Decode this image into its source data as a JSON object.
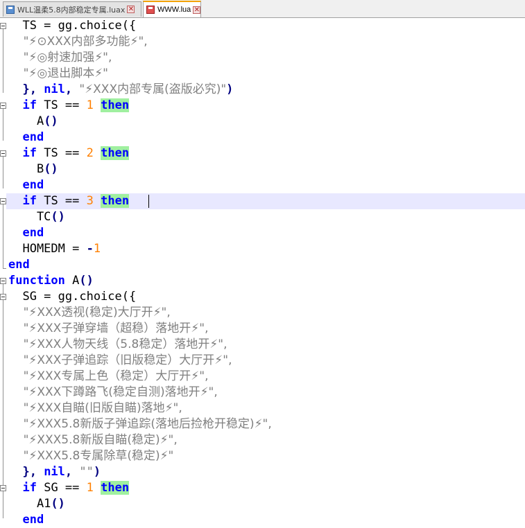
{
  "tabs": [
    {
      "label": "WLL温柔5.8内部稳定专属.luax",
      "active": false
    },
    {
      "label": "WWW.lua",
      "active": true
    }
  ],
  "editor": {
    "lines": [
      [
        {
          "t": "  TS = gg.choice({",
          "c": "id"
        }
      ],
      [
        {
          "t": "    \"⚡⊙XXX内部多功能⚡\",",
          "c": "str"
        }
      ],
      [
        {
          "t": "    \"⚡◎射速加强⚡\",",
          "c": "str"
        }
      ],
      [
        {
          "t": "    \"⚡◎退出脚本⚡\"",
          "c": "str"
        }
      ],
      [
        {
          "t": "  }, ",
          "c": "punc"
        },
        {
          "t": "nil",
          "c": "kw"
        },
        {
          "t": ", ",
          "c": "punc"
        },
        {
          "t": "\"⚡XXX内部专属(盗版必究)\"",
          "c": "str"
        },
        {
          "t": ")",
          "c": "punc"
        }
      ],
      [
        {
          "t": "  ",
          "c": "id"
        },
        {
          "t": "if",
          "c": "kw"
        },
        {
          "t": " TS == ",
          "c": "id"
        },
        {
          "t": "1",
          "c": "num"
        },
        {
          "t": " ",
          "c": "id"
        },
        {
          "t": "then",
          "c": "then"
        }
      ],
      [
        {
          "t": "    A",
          "c": "id"
        },
        {
          "t": "()",
          "c": "punc"
        }
      ],
      [
        {
          "t": "  ",
          "c": "id"
        },
        {
          "t": "end",
          "c": "kw"
        }
      ],
      [
        {
          "t": "  ",
          "c": "id"
        },
        {
          "t": "if",
          "c": "kw"
        },
        {
          "t": " TS == ",
          "c": "id"
        },
        {
          "t": "2",
          "c": "num"
        },
        {
          "t": " ",
          "c": "id"
        },
        {
          "t": "then",
          "c": "then"
        }
      ],
      [
        {
          "t": "    B",
          "c": "id"
        },
        {
          "t": "()",
          "c": "punc"
        }
      ],
      [
        {
          "t": "  ",
          "c": "id"
        },
        {
          "t": "end",
          "c": "kw"
        }
      ],
      [
        {
          "t": "  ",
          "c": "id"
        },
        {
          "t": "if",
          "c": "kw"
        },
        {
          "t": " TS == ",
          "c": "id"
        },
        {
          "t": "3",
          "c": "num"
        },
        {
          "t": " ",
          "c": "id"
        },
        {
          "t": "then",
          "c": "then"
        }
      ],
      [
        {
          "t": "    TC",
          "c": "id"
        },
        {
          "t": "()",
          "c": "punc"
        }
      ],
      [
        {
          "t": "  ",
          "c": "id"
        },
        {
          "t": "end",
          "c": "kw"
        }
      ],
      [
        {
          "t": "  HOMEDM = ",
          "c": "id"
        },
        {
          "t": "-",
          "c": "punc"
        },
        {
          "t": "1",
          "c": "num"
        }
      ],
      [
        {
          "t": "end",
          "c": "kw"
        }
      ],
      [
        {
          "t": "function",
          "c": "kw"
        },
        {
          "t": " A",
          "c": "id"
        },
        {
          "t": "()",
          "c": "punc"
        }
      ],
      [
        {
          "t": "  SG = gg.choice({",
          "c": "id"
        }
      ],
      [
        {
          "t": "    \"⚡XXX透视(稳定)大厅开⚡\",",
          "c": "str"
        }
      ],
      [
        {
          "t": "    \"⚡XXX子弹穿墙（超稳）落地开⚡\",",
          "c": "str"
        }
      ],
      [
        {
          "t": "    \"⚡XXX人物天线（5.8稳定）落地开⚡\",",
          "c": "str"
        }
      ],
      [
        {
          "t": "    \"⚡XXX子弹追踪（旧版稳定）大厅开⚡\",",
          "c": "str"
        }
      ],
      [
        {
          "t": "    \"⚡XXX专属上色（稳定）大厅开⚡\",",
          "c": "str"
        }
      ],
      [
        {
          "t": "    \"⚡XXX下蹲路飞(稳定自测)落地开⚡\",",
          "c": "str"
        }
      ],
      [
        {
          "t": "    \"⚡XXX自瞄(旧版自瞄)落地⚡\",",
          "c": "str"
        }
      ],
      [
        {
          "t": "    \"⚡XXX5.8新版子弹追踪(落地后捡枪开稳定)⚡\",",
          "c": "str"
        }
      ],
      [
        {
          "t": "    \"⚡XXX5.8新版自瞄(稳定)⚡\",",
          "c": "str"
        }
      ],
      [
        {
          "t": "    \"⚡XXX5.8专属除草(稳定)⚡\"",
          "c": "str"
        }
      ],
      [
        {
          "t": "  }, ",
          "c": "punc"
        },
        {
          "t": "nil",
          "c": "kw"
        },
        {
          "t": ", ",
          "c": "punc"
        },
        {
          "t": "\"\"",
          "c": "str"
        },
        {
          "t": ")",
          "c": "punc"
        }
      ],
      [
        {
          "t": "  ",
          "c": "id"
        },
        {
          "t": "if",
          "c": "kw"
        },
        {
          "t": " SG == ",
          "c": "id"
        },
        {
          "t": "1",
          "c": "num"
        },
        {
          "t": " ",
          "c": "id"
        },
        {
          "t": "then",
          "c": "then"
        }
      ],
      [
        {
          "t": "    A1",
          "c": "id"
        },
        {
          "t": "()",
          "c": "punc"
        }
      ],
      [
        {
          "t": "  ",
          "c": "id"
        },
        {
          "t": "end",
          "c": "kw"
        }
      ]
    ],
    "current_line": 12
  }
}
